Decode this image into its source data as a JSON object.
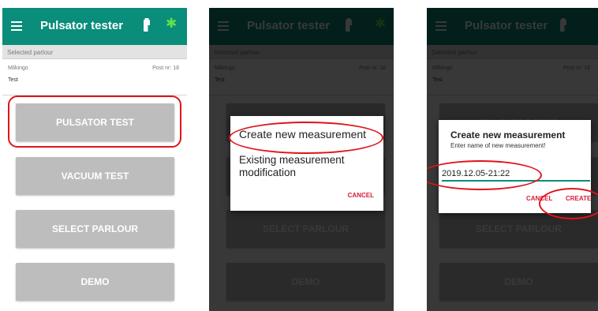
{
  "app": {
    "title": "Pulsator tester",
    "menu_icon": "hamburger-menu-icon",
    "battery_icon": "battery-icon",
    "bluetooth_icon": "bluetooth-icon",
    "bluetooth_glyph": "✱",
    "accent_color": "#0a8d7a",
    "bluetooth_color": "#63e04a",
    "highlight_color": "#e0141c"
  },
  "parlour": {
    "selected_label": "Selected parlour",
    "farm_name": "Milkingo",
    "post_label": "Post nr: 18",
    "test_name": "Test"
  },
  "main_buttons": {
    "pulsator_test": "PULSATOR TEST",
    "vacuum_test": "VACUUM TEST",
    "select_parlour": "SELECT PARLOUR",
    "demo": "DEMO"
  },
  "choice_dialog": {
    "option_create": "Create new measurement",
    "option_modify": "Existing measurement modification",
    "cancel_label": "CANCEL"
  },
  "name_dialog": {
    "title": "Create new measurement",
    "subtitle": "Enter name of new measurement!",
    "input_value": "2019.12.05-21:22",
    "cancel_label": "CANCEL",
    "create_label": "CREATE"
  }
}
